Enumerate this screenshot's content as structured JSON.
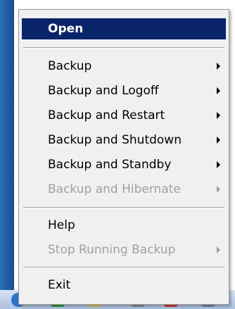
{
  "menu": {
    "open": {
      "label": "Open"
    },
    "backup": {
      "label": "Backup"
    },
    "backup_logoff": {
      "label": "Backup and Logoff"
    },
    "backup_restart": {
      "label": "Backup and Restart"
    },
    "backup_shutdown": {
      "label": "Backup and Shutdown"
    },
    "backup_standby": {
      "label": "Backup and Standby"
    },
    "backup_hibernate": {
      "label": "Backup and Hibernate"
    },
    "help": {
      "label": "Help"
    },
    "stop_backup": {
      "label": "Stop Running Backup"
    },
    "exit": {
      "label": "Exit"
    }
  },
  "colors": {
    "highlight": "#0a246a",
    "disabled_text": "#a0a0a0",
    "menu_background": "#f0f0f0"
  },
  "icons": [
    "arrow-right-icon",
    "checkmark-tray-icon",
    "network-tray-icon",
    "battery-tray-icon",
    "error-tray-icon",
    "monitor-tray-icon",
    "clock-tray-icon"
  ]
}
